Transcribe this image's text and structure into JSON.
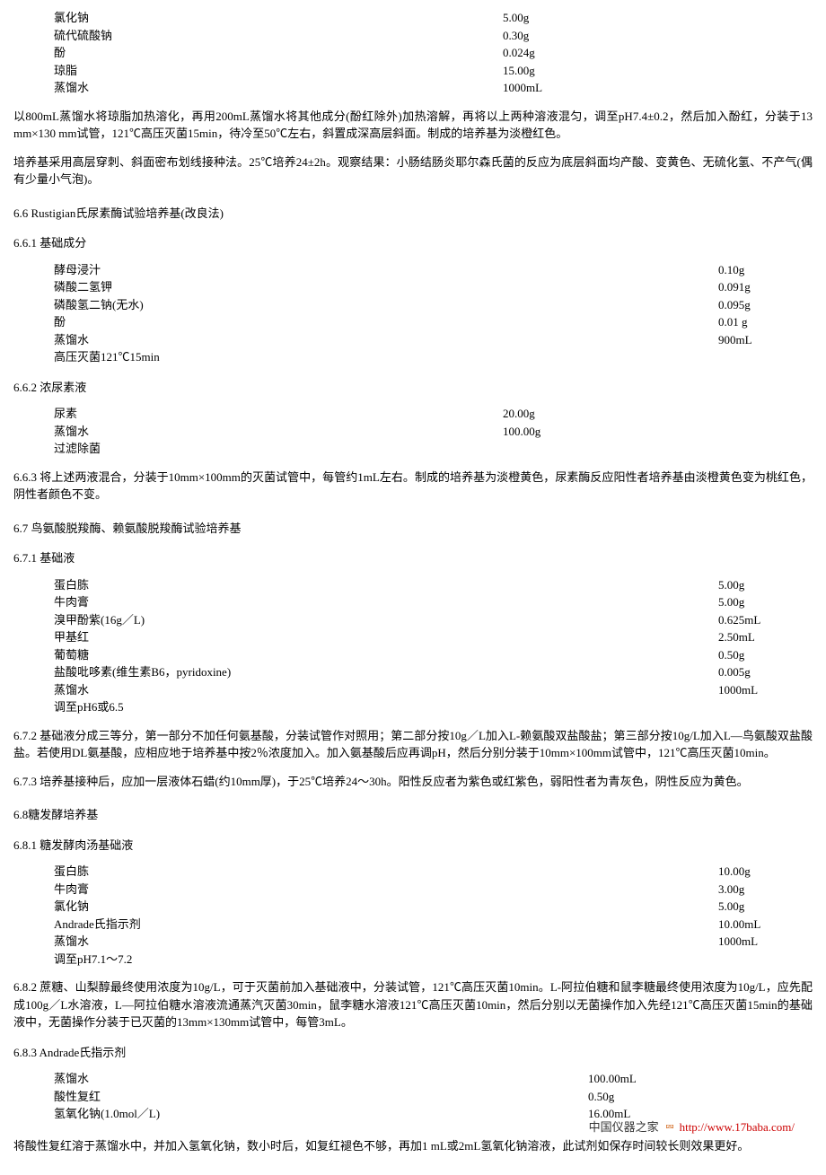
{
  "top_ingredients": [
    {
      "name": "氯化钠",
      "amount": "5.00g"
    },
    {
      "name": "硫代硫酸钠",
      "amount": "0.30g"
    },
    {
      "name": "酚",
      "amount": "0.024g"
    },
    {
      "name": "琼脂",
      "amount": "15.00g"
    },
    {
      "name": "蒸馏水",
      "amount": "1000mL"
    }
  ],
  "para_prep1": "以800mL蒸馏水将琼脂加热溶化，再用200mL蒸馏水将其他成分(酚红除外)加热溶解，再将以上两种溶液混匀，调至pH7.4±0.2，然后加入酚红，分装于13 mm×130 mm试管，121℃高压灭菌15min，待冷至50℃左右，斜置成深高层斜面。制成的培养基为淡橙红色。",
  "para_prep2": "培养基采用高层穿刺、斜面密布划线接种法。25℃培养24±2h。观察结果：小肠结肠炎耶尔森氏菌的反应为底层斜面均产酸、变黄色、无硫化氢、不产气(偶有少量小气泡)。",
  "s66_heading": "6.6 Rustigian氏尿素酶试验培养基(改良法)",
  "s661_heading": "6.6.1 基础成分",
  "s661_ingredients": [
    {
      "name": "酵母浸汁",
      "amount": "0.10g"
    },
    {
      "name": "磷酸二氢钾",
      "amount": "0.091g"
    },
    {
      "name": "磷酸氢二钠(无水)",
      "amount": "0.095g"
    },
    {
      "name": "酚",
      "amount": "0.01 g"
    },
    {
      "name": "蒸馏水",
      "amount": "900mL"
    },
    {
      "name": "高压灭菌121℃15min",
      "amount": ""
    }
  ],
  "s662_heading": "6.6.2 浓尿素液",
  "s662_ingredients": [
    {
      "name": "尿素",
      "amount": "20.00g"
    },
    {
      "name": "蒸馏水",
      "amount": "100.00g"
    },
    {
      "name": "过滤除菌",
      "amount": ""
    }
  ],
  "s663_para": "6.6.3 将上述两液混合，分装于10mm×100mm的灭菌试管中，每管约1mL左右。制成的培养基为淡橙黄色，尿素酶反应阳性者培养基由淡橙黄色变为桃红色，阴性者颜色不变。",
  "s67_heading": "6.7 鸟氨酸脱羧酶、赖氨酸脱羧酶试验培养基",
  "s671_heading": "6.7.1 基础液",
  "s671_ingredients": [
    {
      "name": "蛋白胨",
      "amount": "5.00g"
    },
    {
      "name": "牛肉膏",
      "amount": "5.00g"
    },
    {
      "name": "溴甲酚紫(16g／L)",
      "amount": "0.625mL"
    },
    {
      "name": "甲基红",
      "amount": "2.50mL"
    },
    {
      "name": "葡萄糖",
      "amount": "0.50g"
    },
    {
      "name": "盐酸吡哆素(维生素B6，pyridoxine)",
      "amount": "0.005g"
    },
    {
      "name": "蒸馏水",
      "amount": "1000mL"
    },
    {
      "name": "调至pH6或6.5",
      "amount": ""
    }
  ],
  "s672_para": "6.7.2 基础液分成三等分，第一部分不加任何氨基酸，分装试管作对照用；第二部分按10g／L加入L-赖氨酸双盐酸盐；第三部分按10g/L加入L—鸟氨酸双盐酸盐。若使用DL氨基酸，应相应地于培养基中按2％浓度加入。加入氨基酸后应再调pH，然后分别分装于10mm×100mm试管中，121℃高压灭菌10min。",
  "s673_para": "6.7.3 培养基接种后，应加一层液体石蜡(约10mm厚)，于25℃培养24～30h。阳性反应者为紫色或红紫色，弱阳性者为青灰色，阴性反应为黄色。",
  "s68_heading": "6.8糖发酵培养基",
  "s681_heading": "6.8.1 糖发酵肉汤基础液",
  "s681_ingredients": [
    {
      "name": "蛋白胨",
      "amount": "10.00g"
    },
    {
      "name": "牛肉膏",
      "amount": "3.00g"
    },
    {
      "name": "氯化钠",
      "amount": "5.00g"
    },
    {
      "name": "Andrade氏指示剂",
      "amount": "10.00mL"
    },
    {
      "name": "蒸馏水",
      "amount": "1000mL"
    },
    {
      "name": "调至pH7.1～7.2",
      "amount": ""
    }
  ],
  "s682_para": "6.8.2 蔗糖、山梨醇最终使用浓度为10g/L，可于灭菌前加入基础液中，分装试管，121℃高压灭菌10min。L-阿拉伯糖和鼠李糖最终使用浓度为10g/L，应先配成100g／L水溶液，L—阿拉伯糖水溶液流通蒸汽灭菌30min，鼠李糖水溶液121℃高压灭菌10min，然后分别以无菌操作加入先经121℃高压灭菌15min的基础液中，无菌操作分装于已灭菌的13mm×130mm试管中，每管3mL。",
  "s683_heading": "6.8.3 Andrade氏指示剂",
  "s683_ingredients": [
    {
      "name": "蒸馏水",
      "amount": "100.00mL"
    },
    {
      "name": "酸性复红",
      "amount": "0.50g"
    },
    {
      "name": "氢氧化钠(1.0mol／L)",
      "amount": "16.00mL"
    }
  ],
  "final_para": "将酸性复红溶于蒸馏水中，并加入氢氧化钠，数小时后，如复红褪色不够，再加1 mL或2mL氢氧化钠溶液，此试剂如保存时间较长则效果更好。",
  "footer": {
    "brand": "中国仪器之家",
    "url": "http://www.17baba.com/"
  }
}
